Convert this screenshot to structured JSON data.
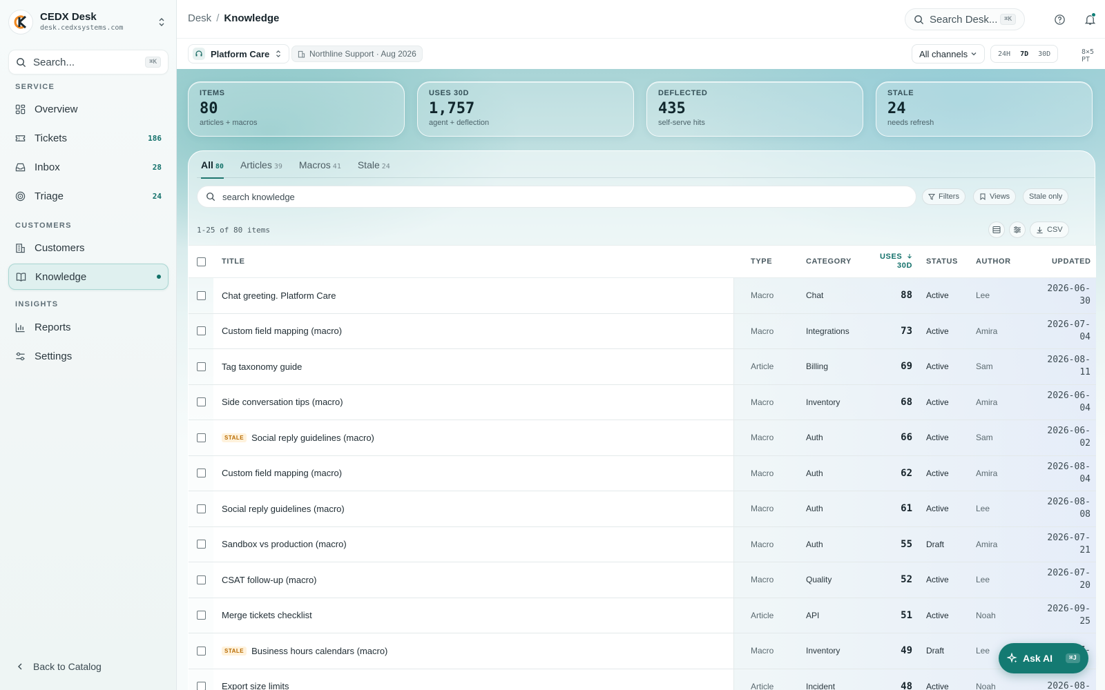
{
  "brand": {
    "name": "CEDX Desk",
    "domain": "desk.cedxsystems.com"
  },
  "sidebar": {
    "search_placeholder": "Search...",
    "search_shortcut": "⌘K",
    "sections": {
      "service": "SERVICE",
      "customers": "CUSTOMERS",
      "insights": "INSIGHTS"
    },
    "items": [
      {
        "label": "Overview",
        "icon": "grid-icon"
      },
      {
        "label": "Tickets",
        "icon": "ticket-icon",
        "count": "186"
      },
      {
        "label": "Inbox",
        "icon": "inbox-icon",
        "count": "28"
      },
      {
        "label": "Triage",
        "icon": "target-icon",
        "count": "24"
      },
      {
        "label": "Customers",
        "icon": "building-icon"
      },
      {
        "label": "Knowledge",
        "icon": "book-icon",
        "active": true
      },
      {
        "label": "Reports",
        "icon": "bar-chart-icon"
      },
      {
        "label": "Settings",
        "icon": "sliders-icon"
      }
    ],
    "back_label": "Back to Catalog"
  },
  "topbar": {
    "breadcrumb_root": "Desk",
    "breadcrumb_sep": "/",
    "breadcrumb_current": "Knowledge",
    "search_placeholder": "Search Desk...",
    "search_shortcut": "⌘K"
  },
  "subbar": {
    "workspace": "Platform Care",
    "period": "Northline Support · Aug 2026",
    "channel": "All channels",
    "ranges": [
      "24H",
      "7D",
      "30D"
    ],
    "active_range": "7D",
    "hours": "8×5 PT"
  },
  "stats": [
    {
      "label": "ITEMS",
      "value": "80",
      "sub": "articles + macros"
    },
    {
      "label": "USES 30D",
      "value": "1,757",
      "sub": "agent + deflection"
    },
    {
      "label": "DEFLECTED",
      "value": "435",
      "sub": "self-serve hits"
    },
    {
      "label": "STALE",
      "value": "24",
      "sub": "needs refresh"
    }
  ],
  "tabs": [
    {
      "label": "All",
      "count": "80",
      "active": true
    },
    {
      "label": "Articles",
      "count": "39"
    },
    {
      "label": "Macros",
      "count": "41"
    },
    {
      "label": "Stale",
      "count": "24"
    }
  ],
  "toolbar": {
    "search_placeholder": "search knowledge",
    "filters": "Filters",
    "views": "Views",
    "stale_only": "Stale only",
    "count_text": "1-25 of 80 items",
    "csv": "CSV"
  },
  "table": {
    "headers": {
      "title": "TITLE",
      "type": "TYPE",
      "category": "CATEGORY",
      "uses_line1": "USES",
      "uses_line2": "30D",
      "status": "STATUS",
      "author": "AUTHOR",
      "updated": "UPDATED"
    },
    "stale_badge": "STALE",
    "rows": [
      {
        "title": "Chat greeting. Platform Care",
        "stale": false,
        "type": "Macro",
        "category": "Chat",
        "uses": "88",
        "status": "Active",
        "author": "Lee",
        "updated_1": "2026-06-",
        "updated_2": "30"
      },
      {
        "title": "Custom field mapping (macro)",
        "stale": false,
        "type": "Macro",
        "category": "Integrations",
        "uses": "73",
        "status": "Active",
        "author": "Amira",
        "updated_1": "2026-07-",
        "updated_2": "04"
      },
      {
        "title": "Tag taxonomy guide",
        "stale": false,
        "type": "Article",
        "category": "Billing",
        "uses": "69",
        "status": "Active",
        "author": "Sam",
        "updated_1": "2026-08-",
        "updated_2": "11"
      },
      {
        "title": "Side conversation tips (macro)",
        "stale": false,
        "type": "Macro",
        "category": "Inventory",
        "uses": "68",
        "status": "Active",
        "author": "Amira",
        "updated_1": "2026-06-",
        "updated_2": "04"
      },
      {
        "title": "Social reply guidelines (macro)",
        "stale": true,
        "type": "Macro",
        "category": "Auth",
        "uses": "66",
        "status": "Active",
        "author": "Sam",
        "updated_1": "2026-06-",
        "updated_2": "02"
      },
      {
        "title": "Custom field mapping (macro)",
        "stale": false,
        "type": "Macro",
        "category": "Auth",
        "uses": "62",
        "status": "Active",
        "author": "Amira",
        "updated_1": "2026-08-",
        "updated_2": "04"
      },
      {
        "title": "Social reply guidelines (macro)",
        "stale": false,
        "type": "Macro",
        "category": "Auth",
        "uses": "61",
        "status": "Active",
        "author": "Lee",
        "updated_1": "2026-08-",
        "updated_2": "08"
      },
      {
        "title": "Sandbox vs production (macro)",
        "stale": false,
        "type": "Macro",
        "category": "Auth",
        "uses": "55",
        "status": "Draft",
        "author": "Amira",
        "updated_1": "2026-07-",
        "updated_2": "21"
      },
      {
        "title": "CSAT follow-up (macro)",
        "stale": false,
        "type": "Macro",
        "category": "Quality",
        "uses": "52",
        "status": "Active",
        "author": "Lee",
        "updated_1": "2026-07-",
        "updated_2": "20"
      },
      {
        "title": "Merge tickets checklist",
        "stale": false,
        "type": "Article",
        "category": "API",
        "uses": "51",
        "status": "Active",
        "author": "Noah",
        "updated_1": "2026-09-",
        "updated_2": "25"
      },
      {
        "title": "Business hours calendars (macro)",
        "stale": true,
        "type": "Macro",
        "category": "Inventory",
        "uses": "49",
        "status": "Draft",
        "author": "Lee",
        "updated_1": "2026-07-",
        "updated_2": ""
      },
      {
        "title": "Export size limits",
        "stale": false,
        "type": "Article",
        "category": "Incident",
        "uses": "48",
        "status": "Active",
        "author": "Noah",
        "updated_1": "2026-08-",
        "updated_2": ""
      }
    ]
  },
  "ask_ai": {
    "label": "Ask AI",
    "shortcut": "⌘J"
  },
  "colors": {
    "accent": "#127168",
    "stale": "#b86a00"
  }
}
